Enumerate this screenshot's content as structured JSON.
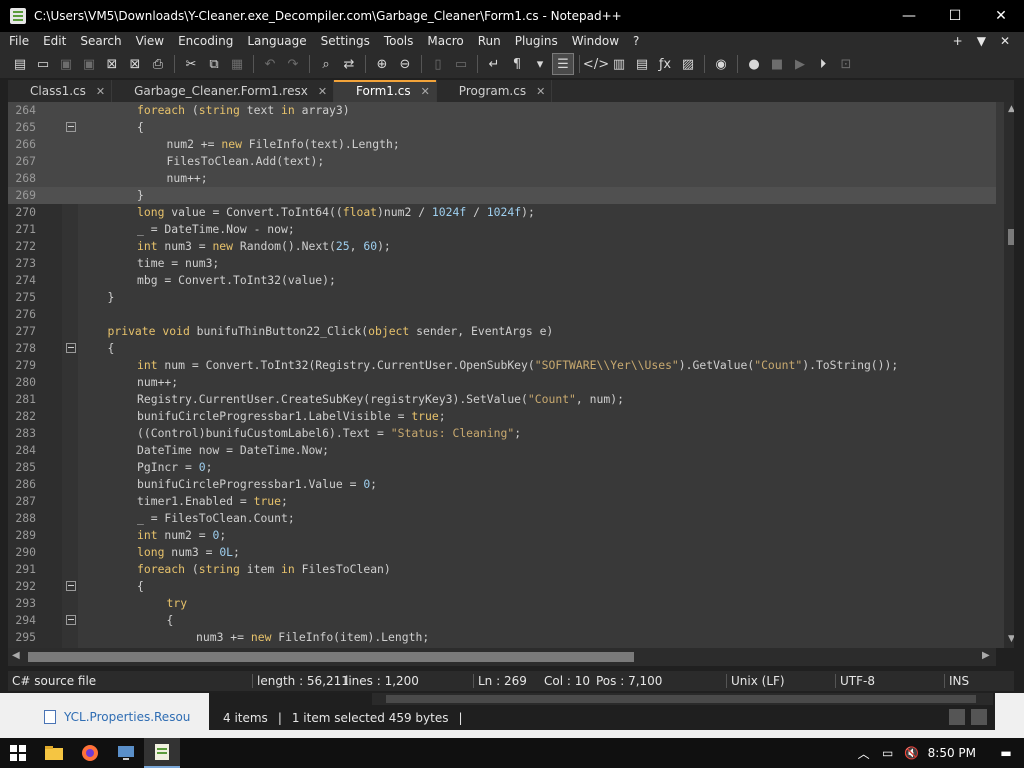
{
  "window": {
    "title": "C:\\Users\\VM5\\Downloads\\Y-Cleaner.exe_Decompiler.com\\Garbage_Cleaner\\Form1.cs - Notepad++",
    "min_glyph": "—",
    "max_glyph": "☐",
    "close_glyph": "✕"
  },
  "menu": {
    "items": [
      "File",
      "Edit",
      "Search",
      "View",
      "Encoding",
      "Language",
      "Settings",
      "Tools",
      "Macro",
      "Run",
      "Plugins",
      "Window",
      "?"
    ],
    "right": [
      "+",
      "▼",
      "✕"
    ]
  },
  "toolbar": {
    "icons": [
      {
        "name": "new-file-icon",
        "glyph": "▤",
        "dim": false
      },
      {
        "name": "open-file-icon",
        "glyph": "▭",
        "dim": false
      },
      {
        "name": "save-icon",
        "glyph": "▣",
        "dim": true
      },
      {
        "name": "save-all-icon",
        "glyph": "▣",
        "dim": true
      },
      {
        "name": "close-icon",
        "glyph": "⊠",
        "dim": false
      },
      {
        "name": "close-all-icon",
        "glyph": "⊠",
        "dim": false
      },
      {
        "name": "print-icon",
        "glyph": "⎙",
        "dim": false
      },
      {
        "name": "sep",
        "glyph": "",
        "dim": false
      },
      {
        "name": "cut-icon",
        "glyph": "✂",
        "dim": false
      },
      {
        "name": "copy-icon",
        "glyph": "⧉",
        "dim": false
      },
      {
        "name": "paste-icon",
        "glyph": "▦",
        "dim": true
      },
      {
        "name": "sep",
        "glyph": "",
        "dim": false
      },
      {
        "name": "undo-icon",
        "glyph": "↶",
        "dim": true
      },
      {
        "name": "redo-icon",
        "glyph": "↷",
        "dim": true
      },
      {
        "name": "sep",
        "glyph": "",
        "dim": false
      },
      {
        "name": "find-icon",
        "glyph": "⌕",
        "dim": false
      },
      {
        "name": "replace-icon",
        "glyph": "⇄",
        "dim": false
      },
      {
        "name": "sep",
        "glyph": "",
        "dim": false
      },
      {
        "name": "zoom-in-icon",
        "glyph": "⊕",
        "dim": false
      },
      {
        "name": "zoom-out-icon",
        "glyph": "⊖",
        "dim": false
      },
      {
        "name": "sep",
        "glyph": "",
        "dim": false
      },
      {
        "name": "sync-vertical-icon",
        "glyph": "▯",
        "dim": true
      },
      {
        "name": "sync-horizontal-icon",
        "glyph": "▭",
        "dim": true
      },
      {
        "name": "sep",
        "glyph": "",
        "dim": false
      },
      {
        "name": "word-wrap-icon",
        "glyph": "↵",
        "dim": false
      },
      {
        "name": "show-all-chars-icon",
        "glyph": "¶",
        "dim": false
      },
      {
        "name": "dropdown-icon",
        "glyph": "▾",
        "dim": false
      },
      {
        "name": "indent-guide-icon",
        "glyph": "☰",
        "dim": false,
        "active": true
      },
      {
        "name": "sep",
        "glyph": "",
        "dim": false
      },
      {
        "name": "language-icon",
        "glyph": "</>",
        "dim": false
      },
      {
        "name": "document-map-icon",
        "glyph": "▥",
        "dim": false
      },
      {
        "name": "document-list-icon",
        "glyph": "▤",
        "dim": false
      },
      {
        "name": "function-list-icon",
        "glyph": "ƒx",
        "dim": false
      },
      {
        "name": "folder-workspace-icon",
        "glyph": "▨",
        "dim": false
      },
      {
        "name": "sep",
        "glyph": "",
        "dim": false
      },
      {
        "name": "monitoring-icon",
        "glyph": "◉",
        "dim": false
      },
      {
        "name": "sep",
        "glyph": "",
        "dim": false
      },
      {
        "name": "record-macro-icon",
        "glyph": "●",
        "dim": false
      },
      {
        "name": "stop-macro-icon",
        "glyph": "■",
        "dim": true
      },
      {
        "name": "play-macro-icon",
        "glyph": "▶",
        "dim": true
      },
      {
        "name": "run-macro-multiple-icon",
        "glyph": "⏵",
        "dim": false
      },
      {
        "name": "save-macro-icon",
        "glyph": "⊡",
        "dim": true
      }
    ]
  },
  "tabs": [
    {
      "label": "Class1.cs",
      "active": false
    },
    {
      "label": "Garbage_Cleaner.Form1.resx",
      "active": false
    },
    {
      "label": "Form1.cs",
      "active": true
    },
    {
      "label": "Program.cs",
      "active": false
    }
  ],
  "editor": {
    "lines": [
      {
        "num": "264",
        "fold": false,
        "hl": true,
        "indent": 2,
        "tokens": [
          [
            "kw",
            "foreach"
          ],
          [
            "op",
            " ("
          ],
          [
            "kw",
            "string"
          ],
          [
            "op",
            " text "
          ],
          [
            "kw",
            "in"
          ],
          [
            "op",
            " array3)"
          ]
        ]
      },
      {
        "num": "265",
        "fold": true,
        "hl": true,
        "indent": 2,
        "tokens": [
          [
            "op",
            "{"
          ]
        ]
      },
      {
        "num": "266",
        "fold": false,
        "hl": true,
        "indent": 3,
        "tokens": [
          [
            "op",
            "num2 += "
          ],
          [
            "kw",
            "new"
          ],
          [
            "op",
            " FileInfo(text).Length;"
          ]
        ]
      },
      {
        "num": "267",
        "fold": false,
        "hl": true,
        "indent": 3,
        "tokens": [
          [
            "op",
            "FilesToClean.Add(text);"
          ]
        ]
      },
      {
        "num": "268",
        "fold": false,
        "hl": true,
        "indent": 3,
        "tokens": [
          [
            "op",
            "num++;"
          ]
        ]
      },
      {
        "num": "269",
        "fold": false,
        "hl": false,
        "cur": true,
        "indent": 2,
        "tokens": [
          [
            "op",
            "}"
          ]
        ]
      },
      {
        "num": "270",
        "fold": false,
        "hl": false,
        "indent": 2,
        "tokens": [
          [
            "kw",
            "long"
          ],
          [
            "op",
            " value = Convert.ToInt64(("
          ],
          [
            "kw",
            "float"
          ],
          [
            "op",
            ")num2 / "
          ],
          [
            "nm",
            "1024f"
          ],
          [
            "op",
            " / "
          ],
          [
            "nm",
            "1024f"
          ],
          [
            "op",
            ");"
          ]
        ]
      },
      {
        "num": "271",
        "fold": false,
        "hl": false,
        "indent": 2,
        "tokens": [
          [
            "op",
            "_ = DateTime.Now - now;"
          ]
        ]
      },
      {
        "num": "272",
        "fold": false,
        "hl": false,
        "indent": 2,
        "tokens": [
          [
            "kw",
            "int"
          ],
          [
            "op",
            " num3 = "
          ],
          [
            "kw",
            "new"
          ],
          [
            "op",
            " Random().Next("
          ],
          [
            "nm",
            "25"
          ],
          [
            "op",
            ", "
          ],
          [
            "nm",
            "60"
          ],
          [
            "op",
            ");"
          ]
        ]
      },
      {
        "num": "273",
        "fold": false,
        "hl": false,
        "indent": 2,
        "tokens": [
          [
            "op",
            "time = num3;"
          ]
        ]
      },
      {
        "num": "274",
        "fold": false,
        "hl": false,
        "indent": 2,
        "tokens": [
          [
            "op",
            "mbg = Convert.ToInt32(value);"
          ]
        ]
      },
      {
        "num": "275",
        "fold": false,
        "hl": false,
        "indent": 1,
        "tokens": [
          [
            "op",
            "}"
          ]
        ]
      },
      {
        "num": "276",
        "fold": false,
        "hl": false,
        "indent": 0,
        "tokens": []
      },
      {
        "num": "277",
        "fold": false,
        "hl": false,
        "indent": 1,
        "tokens": [
          [
            "kw",
            "private"
          ],
          [
            "op",
            " "
          ],
          [
            "kw",
            "void"
          ],
          [
            "op",
            " bunifuThinButton22_Click("
          ],
          [
            "kw",
            "object"
          ],
          [
            "op",
            " sender, EventArgs e)"
          ]
        ]
      },
      {
        "num": "278",
        "fold": true,
        "hl": false,
        "indent": 1,
        "tokens": [
          [
            "op",
            "{"
          ]
        ]
      },
      {
        "num": "279",
        "fold": false,
        "hl": false,
        "indent": 2,
        "tokens": [
          [
            "kw",
            "int"
          ],
          [
            "op",
            " num = Convert.ToInt32(Registry.CurrentUser.OpenSubKey("
          ],
          [
            "str",
            "\"SOFTWARE\\\\Yer\\\\Uses\""
          ],
          [
            "op",
            ").GetValue("
          ],
          [
            "str",
            "\"Count\""
          ],
          [
            "op",
            ").ToString());"
          ]
        ]
      },
      {
        "num": "280",
        "fold": false,
        "hl": false,
        "indent": 2,
        "tokens": [
          [
            "op",
            "num++;"
          ]
        ]
      },
      {
        "num": "281",
        "fold": false,
        "hl": false,
        "indent": 2,
        "tokens": [
          [
            "op",
            "Registry.CurrentUser.CreateSubKey(registryKey3).SetValue("
          ],
          [
            "str",
            "\"Count\""
          ],
          [
            "op",
            ", num);"
          ]
        ]
      },
      {
        "num": "282",
        "fold": false,
        "hl": false,
        "indent": 2,
        "tokens": [
          [
            "op",
            "bunifuCircleProgressbar1.LabelVisible = "
          ],
          [
            "kw",
            "true"
          ],
          [
            "op",
            ";"
          ]
        ]
      },
      {
        "num": "283",
        "fold": false,
        "hl": false,
        "indent": 2,
        "tokens": [
          [
            "op",
            "((Control)bunifuCustomLabel6).Text = "
          ],
          [
            "str",
            "\"Status: Cleaning\""
          ],
          [
            "op",
            ";"
          ]
        ]
      },
      {
        "num": "284",
        "fold": false,
        "hl": false,
        "indent": 2,
        "tokens": [
          [
            "op",
            "DateTime now = DateTime.Now;"
          ]
        ]
      },
      {
        "num": "285",
        "fold": false,
        "hl": false,
        "indent": 2,
        "tokens": [
          [
            "op",
            "PgIncr = "
          ],
          [
            "nm",
            "0"
          ],
          [
            "op",
            ";"
          ]
        ]
      },
      {
        "num": "286",
        "fold": false,
        "hl": false,
        "indent": 2,
        "tokens": [
          [
            "op",
            "bunifuCircleProgressbar1.Value = "
          ],
          [
            "nm",
            "0"
          ],
          [
            "op",
            ";"
          ]
        ]
      },
      {
        "num": "287",
        "fold": false,
        "hl": false,
        "indent": 2,
        "tokens": [
          [
            "op",
            "timer1.Enabled = "
          ],
          [
            "kw",
            "true"
          ],
          [
            "op",
            ";"
          ]
        ]
      },
      {
        "num": "288",
        "fold": false,
        "hl": false,
        "indent": 2,
        "tokens": [
          [
            "op",
            "_ = FilesToClean.Count;"
          ]
        ]
      },
      {
        "num": "289",
        "fold": false,
        "hl": false,
        "indent": 2,
        "tokens": [
          [
            "kw",
            "int"
          ],
          [
            "op",
            " num2 = "
          ],
          [
            "nm",
            "0"
          ],
          [
            "op",
            ";"
          ]
        ]
      },
      {
        "num": "290",
        "fold": false,
        "hl": false,
        "indent": 2,
        "tokens": [
          [
            "kw",
            "long"
          ],
          [
            "op",
            " num3 = "
          ],
          [
            "nm",
            "0L"
          ],
          [
            "op",
            ";"
          ]
        ]
      },
      {
        "num": "291",
        "fold": false,
        "hl": false,
        "indent": 2,
        "tokens": [
          [
            "kw",
            "foreach"
          ],
          [
            "op",
            " ("
          ],
          [
            "kw",
            "string"
          ],
          [
            "op",
            " item "
          ],
          [
            "kw",
            "in"
          ],
          [
            "op",
            " FilesToClean)"
          ]
        ]
      },
      {
        "num": "292",
        "fold": true,
        "hl": false,
        "indent": 2,
        "tokens": [
          [
            "op",
            "{"
          ]
        ]
      },
      {
        "num": "293",
        "fold": false,
        "hl": false,
        "indent": 3,
        "tokens": [
          [
            "kw",
            "try"
          ]
        ]
      },
      {
        "num": "294",
        "fold": true,
        "hl": false,
        "indent": 3,
        "tokens": [
          [
            "op",
            "{"
          ]
        ]
      },
      {
        "num": "295",
        "fold": false,
        "hl": false,
        "indent": 4,
        "tokens": [
          [
            "op",
            "num3 += "
          ],
          [
            "kw",
            "new"
          ],
          [
            "op",
            " FileInfo(item).Length;"
          ]
        ]
      }
    ]
  },
  "statusbar": {
    "file_type": "C# source file",
    "length": "length : 56,211",
    "lines": "lines : 1,200",
    "ln": "Ln : 269",
    "col": "Col : 10",
    "pos": "Pos : 7,100",
    "eol": "Unix (LF)",
    "encoding": "UTF-8",
    "mode": "INS"
  },
  "explorer": {
    "item_label": "YCL.Properties.Resou",
    "items_count": "4 items",
    "selected": "1 item selected  459 bytes"
  },
  "taskbar": {
    "time": "8:50 PM"
  },
  "colors": {
    "accent_tab": "#f2a33a",
    "keyword": "#e7c26b",
    "number": "#9ecfef",
    "string": "#c8a96f"
  }
}
